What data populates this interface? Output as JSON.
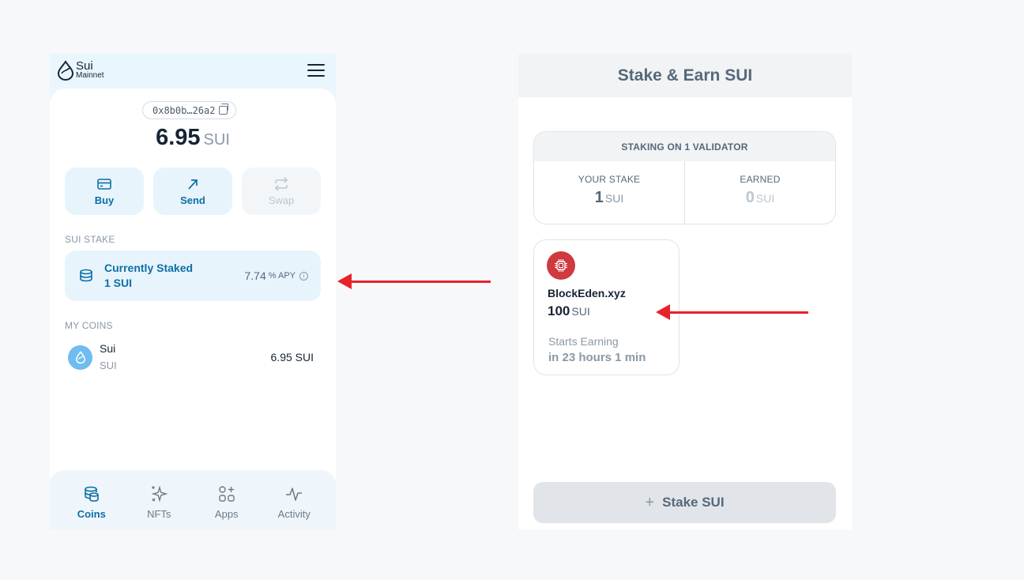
{
  "wallet": {
    "logo_name": "Sui",
    "network": "Mainnet",
    "address": "0x8b0b…26a2",
    "balance_amount": "6.95",
    "balance_unit": "SUI",
    "actions": [
      {
        "label": "Buy",
        "icon": "card-icon",
        "enabled": true
      },
      {
        "label": "Send",
        "icon": "arrow-up-right-icon",
        "enabled": true
      },
      {
        "label": "Swap",
        "icon": "swap-icon",
        "enabled": false
      }
    ],
    "stake_section_title": "SUI STAKE",
    "stake_card": {
      "title": "Currently Staked",
      "amount": "1 SUI",
      "apy_value": "7.74",
      "apy_suffix": "% APY",
      "info_glyph": "i"
    },
    "coins_section_title": "MY COINS",
    "coins": [
      {
        "name": "Sui",
        "symbol": "SUI",
        "balance": "6.95 SUI"
      }
    ],
    "nav": [
      {
        "label": "Coins",
        "icon": "coins-icon",
        "active": true
      },
      {
        "label": "NFTs",
        "icon": "sparkles-icon",
        "active": false
      },
      {
        "label": "Apps",
        "icon": "apps-icon",
        "active": false
      },
      {
        "label": "Activity",
        "icon": "activity-icon",
        "active": false
      }
    ]
  },
  "stake_panel": {
    "title": "Stake & Earn SUI",
    "summary_header": "STAKING ON 1 VALIDATOR",
    "your_stake_label": "YOUR STAKE",
    "your_stake_value": "1",
    "your_stake_unit": "SUI",
    "earned_label": "EARNED",
    "earned_value": "0",
    "earned_unit": "SUI",
    "validator": {
      "name": "BlockEden.xyz",
      "amount": "100",
      "unit": "SUI",
      "note_line1": "Starts Earning",
      "note_line2": "in 23 hours 1 min"
    },
    "button_plus": "+",
    "button_label": "Stake SUI"
  },
  "colors": {
    "accent": "#0d6fa5",
    "arrow": "#e8222a",
    "validator_logo": "#d0393e",
    "sui_coin": "#6fbcf0"
  }
}
